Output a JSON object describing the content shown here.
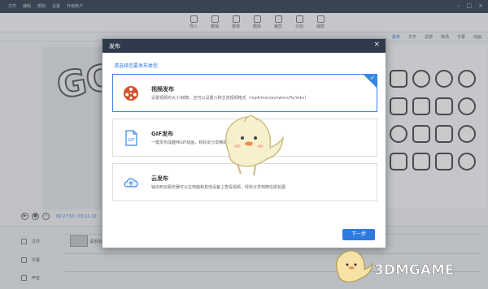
{
  "app": {
    "menu": [
      "文件",
      "编辑",
      "帮助",
      "设置",
      "升级账户"
    ],
    "toolbar": [
      "导入",
      "撤销",
      "重做",
      "删除",
      "裁剪",
      "分割",
      "缩放"
    ],
    "tabs": [
      "素材",
      "文字",
      "滤镜",
      "转场",
      "字幕",
      "动画"
    ],
    "player": {
      "timecode": "00:27.53 / 03:11.10"
    },
    "tracks": [
      {
        "label": "文件",
        "icon": "film-icon"
      },
      {
        "label": "字幕",
        "icon": "text-icon"
      },
      {
        "label": "声音",
        "icon": "music-icon"
      }
    ],
    "clip_label": "请添加素材"
  },
  "dialog": {
    "title": "发布",
    "prompt": "请选择您要发布类型",
    "options": [
      {
        "title": "视频发布",
        "desc": "设置视频的大小/帧数，还可以设置六种主流视频格式（mp4/mov/avi/wmv/flv/mkv）",
        "icon": "film-reel-icon",
        "selected": true
      },
      {
        "title": "GIF发布",
        "desc": "一键发布成趣味GIF动画，和好友分享精彩瞬间",
        "icon": "gif-file-icon",
        "selected": false
      },
      {
        "title": "云发布",
        "desc": "输出到云服务器可以在电脑和其他设备上查看视频，轻松分享到微信朋友圈",
        "icon": "cloud-icon",
        "selected": false
      }
    ],
    "next_label": "下一步"
  },
  "watermark": {
    "text": "3DMGAME"
  },
  "colors": {
    "accent": "#2e7be0",
    "header": "#2f3b4a",
    "border_selected": "#3a86e8"
  }
}
